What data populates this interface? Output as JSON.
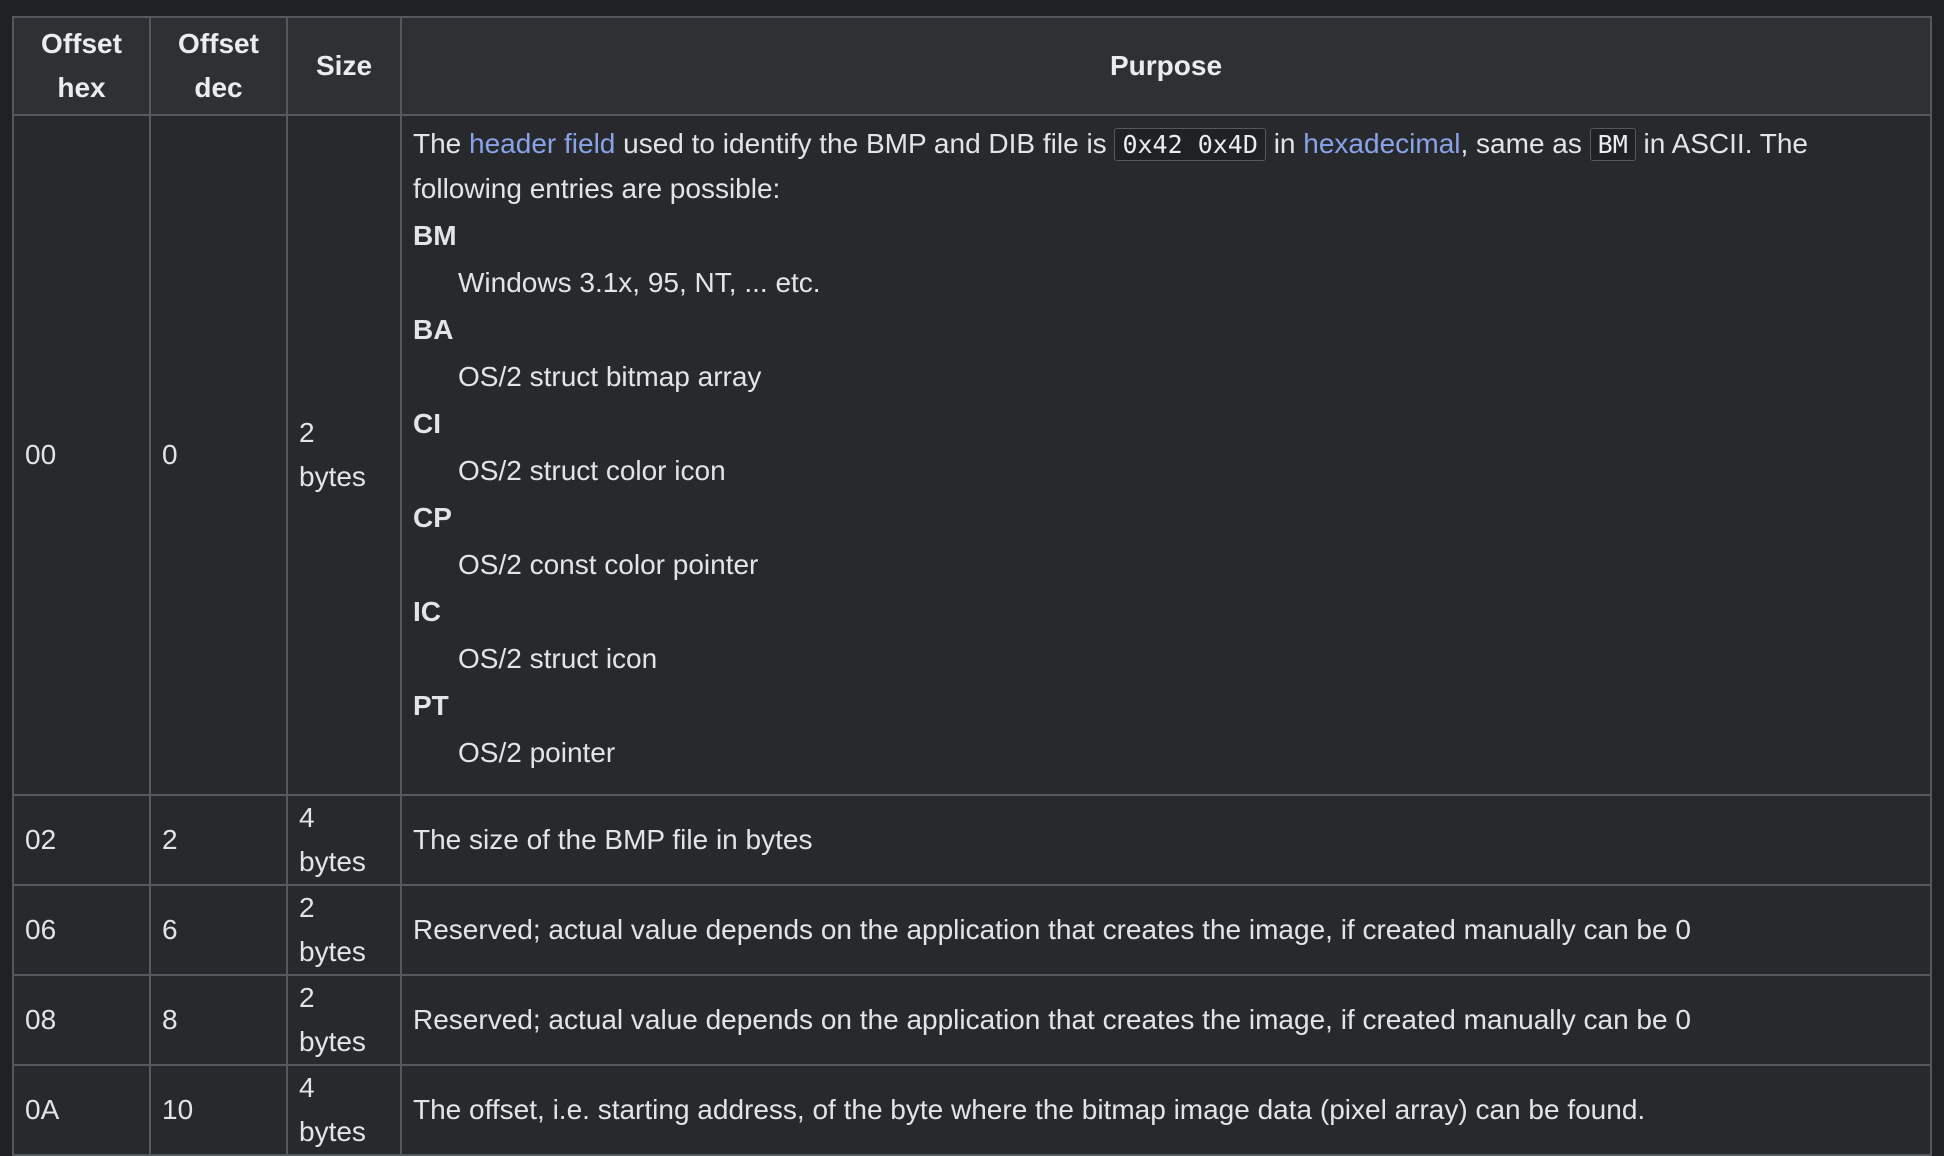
{
  "headers": {
    "offset_hex": [
      "Offset",
      "hex"
    ],
    "offset_dec": [
      "Offset",
      "dec"
    ],
    "size": "Size",
    "purpose": "Purpose"
  },
  "first_row": {
    "offset_hex": "00",
    "offset_dec": "0",
    "size": "2 bytes",
    "intro": {
      "t1": "The ",
      "link1": "header field",
      "t2": " used to identify the BMP and DIB file is ",
      "code1": "0x42 0x4D",
      "t3": " in ",
      "link2": "hexadecimal",
      "t4": ", same as ",
      "code2": "BM",
      "t5": " in ASCII. The following entries are possible:"
    },
    "entries": [
      {
        "term": "BM",
        "desc": "Windows 3.1x, 95, NT, ... etc."
      },
      {
        "term": "BA",
        "desc": "OS/2 struct bitmap array"
      },
      {
        "term": "CI",
        "desc": "OS/2 struct color icon"
      },
      {
        "term": "CP",
        "desc": "OS/2 const color pointer"
      },
      {
        "term": "IC",
        "desc": "OS/2 struct icon"
      },
      {
        "term": "PT",
        "desc": "OS/2 pointer"
      }
    ]
  },
  "rows": [
    {
      "offset_hex": "02",
      "offset_dec": "2",
      "size": "4 bytes",
      "purpose": "The size of the BMP file in bytes"
    },
    {
      "offset_hex": "06",
      "offset_dec": "6",
      "size": "2 bytes",
      "purpose": "Reserved; actual value depends on the application that creates the image, if created manually can be 0"
    },
    {
      "offset_hex": "08",
      "offset_dec": "8",
      "size": "2 bytes",
      "purpose": "Reserved; actual value depends on the application that creates the image, if created manually can be 0"
    },
    {
      "offset_hex": "0A",
      "offset_dec": "10",
      "size": "4 bytes",
      "purpose": "The offset, i.e. starting address, of the byte where the bitmap image data (pixel array) can be found."
    }
  ],
  "colors": {
    "background": "#202122",
    "cell_background": "#27292d",
    "header_background": "#2e3033",
    "border": "#54595d",
    "link": "#88a3e8",
    "text": "#eaecf0"
  }
}
